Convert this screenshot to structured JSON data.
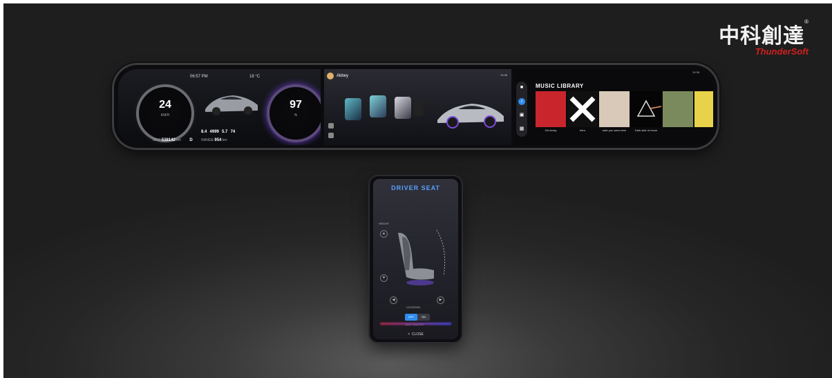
{
  "brand": {
    "chinese": "中科創達",
    "english": "ThunderSoft",
    "registered": "®"
  },
  "cluster": {
    "time": "06:57 PM",
    "temperature": "18 °C",
    "speed_value": "24",
    "speed_unit": "KM/H",
    "battery_value": "97",
    "battery_unit": "%",
    "stat_a": "8.4",
    "stat_b": "4999",
    "stat_c": "5.7",
    "stat_d": "74",
    "odo_label": "ODO",
    "odo_value": "538142",
    "odo_unit": "km",
    "gear": "D",
    "range_label": "RANGE",
    "range_value": "954",
    "range_unit": "km"
  },
  "center": {
    "user_name": "Abbey",
    "status": "10:38"
  },
  "music": {
    "title": "MUSIC LIBRARY",
    "time": "10:38",
    "rail": [
      "video-icon",
      "music-icon",
      "photo-icon",
      "apps-icon"
    ],
    "albums": [
      {
        "name": "Get funky",
        "color": "#c9252d"
      },
      {
        "name": "Intro",
        "color": "#101010"
      },
      {
        "name": "wish you were here",
        "color": "#d8c9b8"
      },
      {
        "name": "Dark side of moon",
        "color": "#050505"
      },
      {
        "name": "",
        "color": "#7b8a5c"
      },
      {
        "name": "",
        "color": "#e8d24a"
      }
    ]
  },
  "phone": {
    "title": "DRIVER SEAT",
    "height_label": "HEIGHT",
    "location_label": "LOCATION",
    "toggle_off": "OFF",
    "toggle_on": "ON",
    "heater_label": "SEAT HEATER",
    "close_label": "CLOSE",
    "close_icon": "×"
  }
}
